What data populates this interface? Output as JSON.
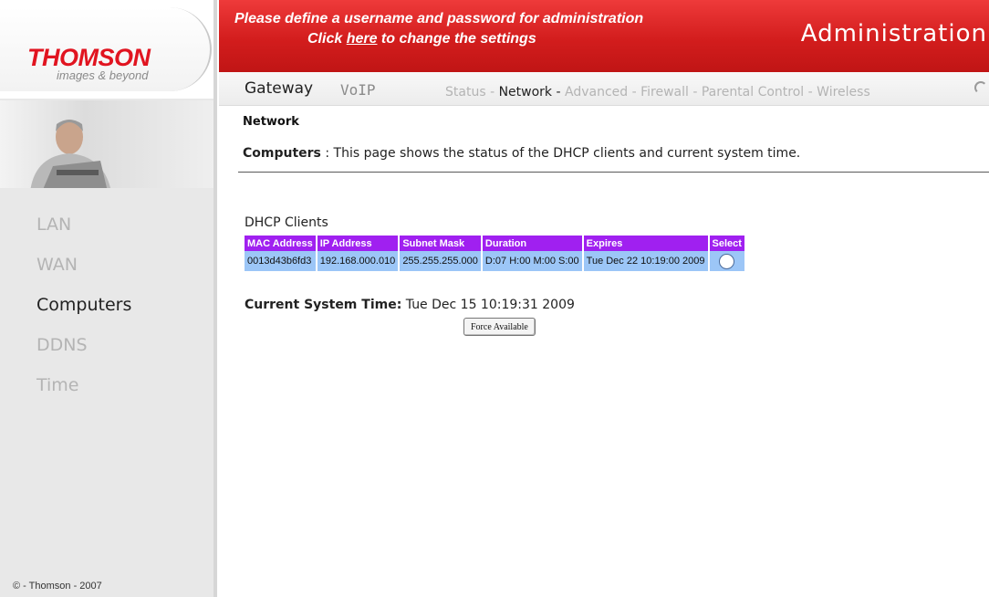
{
  "brand": {
    "name": "THOMSON",
    "tagline": "images & beyond",
    "accent": "#e11420"
  },
  "banner": {
    "line1": "Please define a username and password for administration",
    "line2_prefix": "Click ",
    "line2_link": "here",
    "line2_suffix": " to change the settings",
    "title": "Administration",
    "color": "#d31d1d"
  },
  "nav": {
    "main_tabs": [
      {
        "label": "Gateway"
      },
      {
        "label": "VoIP"
      }
    ],
    "sub_tabs": [
      {
        "label": "Status"
      },
      {
        "label": "Network"
      },
      {
        "label": "Advanced"
      },
      {
        "label": "Firewall"
      },
      {
        "label": "Parental Control"
      },
      {
        "label": "Wireless"
      }
    ],
    "separator": " - "
  },
  "sidebar": {
    "items": [
      {
        "label": "LAN"
      },
      {
        "label": "WAN"
      },
      {
        "label": "Computers"
      },
      {
        "label": "DDNS"
      },
      {
        "label": "Time"
      }
    ],
    "copyright": "© - Thomson - 2007"
  },
  "main": {
    "section_title": "Network",
    "description_label": "Computers",
    "description_sep": " : ",
    "description_text": " This page shows the status of the DHCP clients and current system time."
  },
  "dhcp": {
    "caption": "DHCP Clients",
    "columns": [
      "MAC Address",
      "IP Address",
      "Subnet Mask",
      "Duration",
      "Expires",
      "Select"
    ],
    "rows": [
      {
        "mac": "0013d43b6fd3",
        "ip": "192.168.000.010",
        "mask": "255.255.255.000",
        "duration": "D:07 H:00 M:00 S:00",
        "expires": "Tue Dec 22 10:19:00 2009"
      }
    ],
    "header_color": "#a020f0",
    "row_color": "#9cc6f7"
  },
  "system_time": {
    "label": "Current System Time:",
    "value": " Tue Dec 15 10:19:31 2009"
  },
  "force_button": "Force Available"
}
